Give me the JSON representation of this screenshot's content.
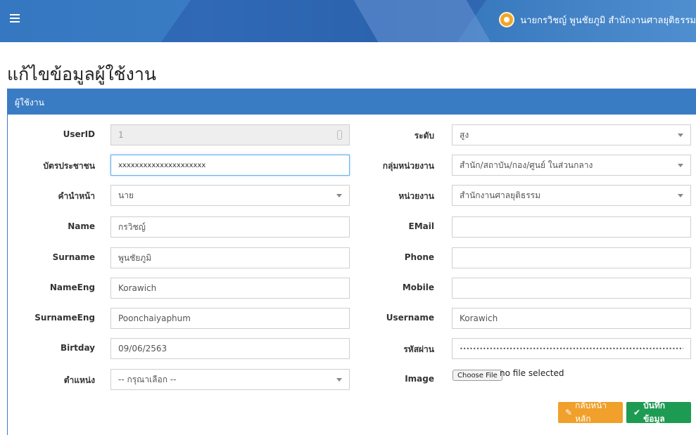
{
  "header": {
    "menu_icon": "hamburger-icon",
    "user_icon": "org-emblem-icon",
    "user_text": "นายกรวิชญ์ พูนชัยภูมิ สำนักงานศาลยุติธรรม"
  },
  "page": {
    "title": "แก้ไขข้อมูลผู้ใช้งาน",
    "panel_title": "ผู้ใช้งาน"
  },
  "form": {
    "left": {
      "userid": {
        "label": "UserID",
        "value": "1"
      },
      "citizen_id": {
        "label": "บัตรประชาชน",
        "value": "xxxxxxxxxxxxxxxxxxxxx"
      },
      "prefix": {
        "label": "คำนำหน้า",
        "value": "นาย"
      },
      "name": {
        "label": "Name",
        "value": "กรวิชญ์"
      },
      "surname": {
        "label": "Surname",
        "value": "พูนชัยภูมิ"
      },
      "name_eng": {
        "label": "NameEng",
        "value": "Korawich"
      },
      "surname_eng": {
        "label": "SurnameEng",
        "value": "Poonchaiyaphum"
      },
      "birthday": {
        "label": "Birtday",
        "value": "09/06/2563"
      },
      "position": {
        "label": "ตำแหน่ง",
        "value": "-- กรุณาเลือก --"
      }
    },
    "right": {
      "level": {
        "label": "ระดับ",
        "value": "สูง"
      },
      "unit_group": {
        "label": "กลุ่มหน่วยงาน",
        "value": "สำนัก/สถาบัน/กอง/ศูนย์ ในส่วนกลาง"
      },
      "unit": {
        "label": "หน่วยงาน",
        "value": "สำนักงานศาลยุติธรรม"
      },
      "email": {
        "label": "EMail",
        "value": ""
      },
      "phone": {
        "label": "Phone",
        "value": ""
      },
      "mobile": {
        "label": "Mobile",
        "value": ""
      },
      "username": {
        "label": "Username",
        "value": "Korawich"
      },
      "password": {
        "label": "รหัสผ่าน",
        "value": "•••••••••••••••••••••••••••••••••••••••••••••••••••••••••••••••••••••••••••••••••••••"
      },
      "image": {
        "label": "Image",
        "button": "Choose File",
        "status": "no file selected"
      }
    }
  },
  "buttons": {
    "back_label": "กลับหน้าหลัก",
    "back_icon": "edit-icon",
    "save_label": "บันทึกข้อมูล",
    "save_icon": "check-icon"
  },
  "colors": {
    "header_blue": "#3a7cc4",
    "back_orange": "#f0a02b",
    "save_green": "#1e9b52"
  }
}
